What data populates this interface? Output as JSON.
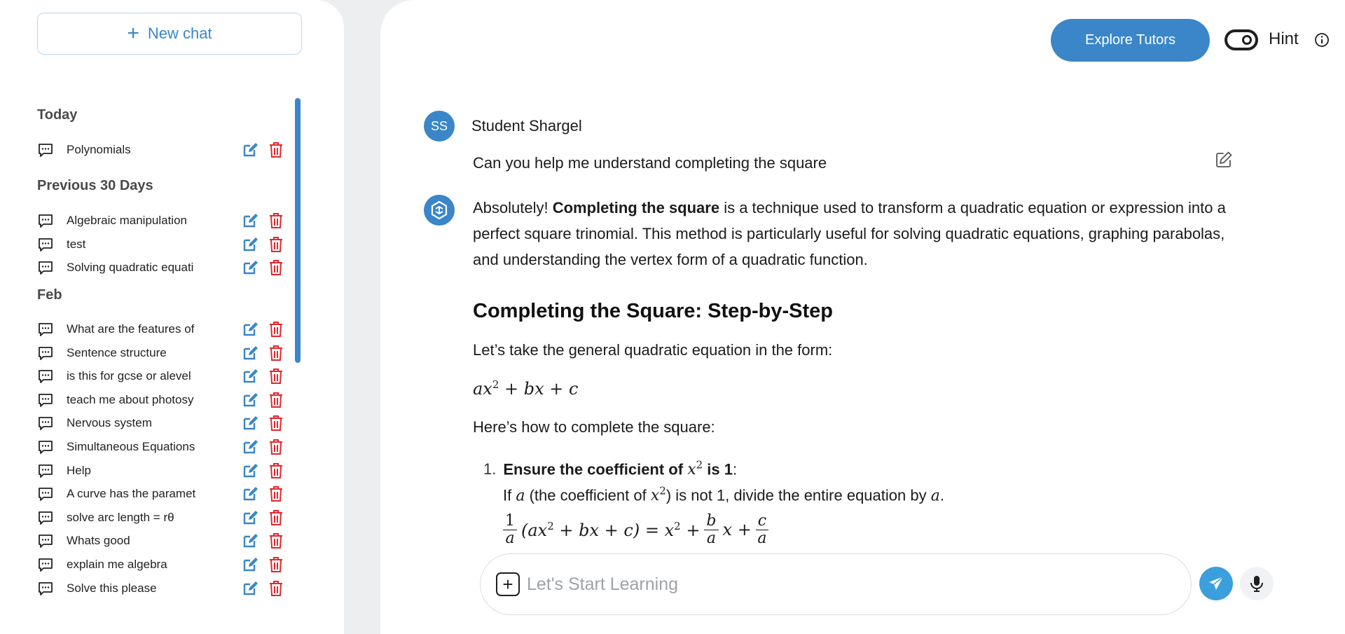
{
  "sidebar": {
    "new_chat_label": "New chat",
    "sections": [
      {
        "title": "Today",
        "items": [
          "Polynomials"
        ]
      },
      {
        "title": "Previous 30 Days",
        "items": [
          "Algebraic manipulation",
          "test",
          "Solving quadratic equati"
        ]
      },
      {
        "title": "Feb",
        "items": [
          "What are the features of",
          "Sentence structure",
          "is this for gcse or alevel",
          "teach me about photosy",
          "Nervous system",
          "Simultaneous Equations",
          "Help",
          "A curve has the paramet",
          "solve arc length = rθ",
          "Whats good",
          "explain me algebra",
          "Solve this please"
        ]
      }
    ]
  },
  "header": {
    "explore_label": "Explore Tutors",
    "hint_label": "Hint"
  },
  "conversation": {
    "user_initials": "SS",
    "user_name": "Student Shargel",
    "user_message": "Can you help me understand completing the square",
    "answer": {
      "intro_start": "Absolutely! ",
      "intro_bold": "Completing the square",
      "intro_rest": " is a technique used to transform a quadratic equation or expression into a perfect square trinomial. This method is particularly useful for solving quadratic equations, graphing parabolas, and understanding the vertex form of a quadratic function.",
      "heading": "Completing the Square: Step-by-Step",
      "p1": "Let’s take the general quadratic equation in the form:",
      "p2": "Here’s how to complete the square:",
      "step1_num": "1.",
      "step1_title_a": "Ensure the coefficient of ",
      "step1_title_b": " is 1",
      "step1_body_a": "If ",
      "step1_body_b": " (the coefficient of ",
      "step1_body_c": ") is not 1, divide the entire equation by "
    }
  },
  "composer": {
    "placeholder": "Let's Start Learning"
  },
  "colors": {
    "accent": "#3a86c8",
    "send": "#3b9edd",
    "danger": "#e0282e"
  }
}
